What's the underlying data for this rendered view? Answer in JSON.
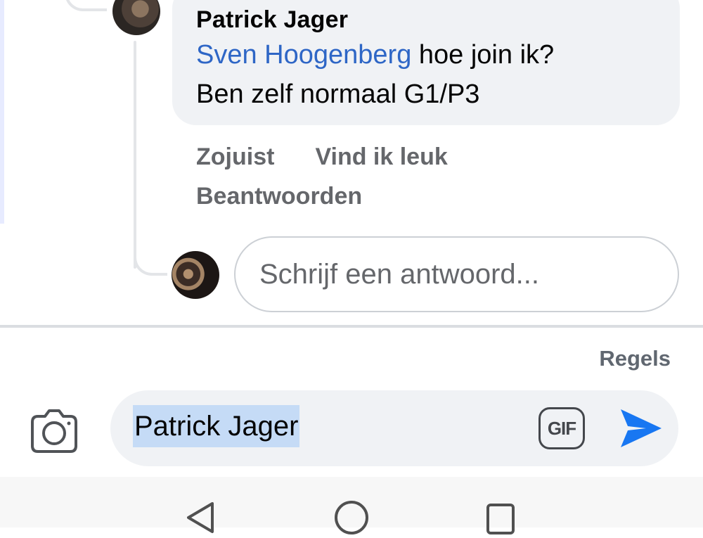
{
  "comment": {
    "author": "Patrick Jager",
    "mention": "Sven Hoogenberg",
    "text_line1_rest": " hoe join ik?",
    "text_line2": "Ben zelf normaal G1/P3",
    "timestamp": "Zojuist",
    "like_label": "Vind ik leuk",
    "reply_label": "Beantwoorden"
  },
  "reply_box": {
    "placeholder": "Schrijf een antwoord..."
  },
  "composer": {
    "rules_label": "Regels",
    "value": "Patrick Jager",
    "gif_label": "GIF"
  },
  "icons": {
    "camera": "camera-icon",
    "send": "send-icon",
    "back": "nav-back-icon",
    "home": "nav-home-icon",
    "recent": "nav-recent-apps-icon"
  },
  "colors": {
    "mention": "#2e66c6",
    "send": "#1877f2",
    "selection": "#c5dbf6"
  }
}
